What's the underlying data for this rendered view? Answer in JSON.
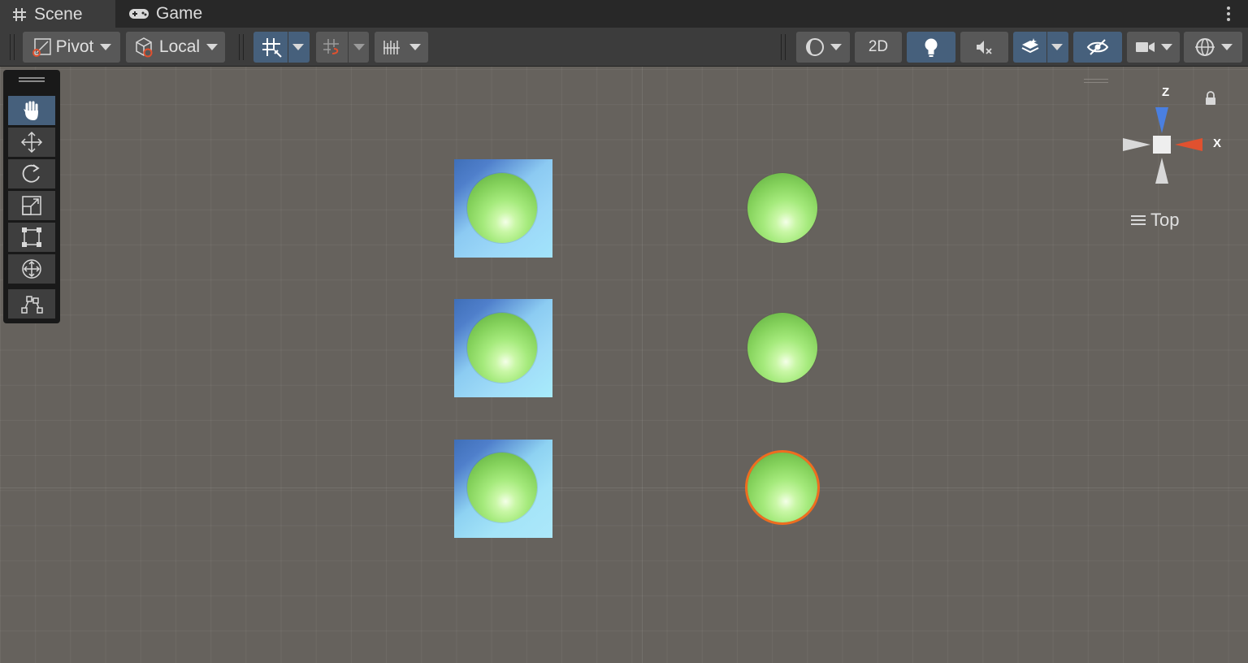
{
  "tabs": [
    {
      "label": "Scene",
      "icon": "grid-hash-icon",
      "active": true
    },
    {
      "label": "Game",
      "icon": "gamepad-icon",
      "active": false
    }
  ],
  "toolbar": {
    "pivot_label": "Pivot",
    "space_label": "Local",
    "mode_2d_label": "2D",
    "grid_snap_active": true,
    "lighting_active": true,
    "visibility_active": true
  },
  "tools": [
    {
      "name": "hand-tool",
      "icon": "hand-icon",
      "active": true
    },
    {
      "name": "move-tool",
      "icon": "move-arrows-icon",
      "active": false
    },
    {
      "name": "rotate-tool",
      "icon": "rotate-icon",
      "active": false
    },
    {
      "name": "scale-tool",
      "icon": "scale-icon",
      "active": false
    },
    {
      "name": "rect-tool",
      "icon": "rect-transform-icon",
      "active": false
    },
    {
      "name": "transform-tool",
      "icon": "transform-icon",
      "active": false
    },
    {
      "name": "custom-tool",
      "icon": "custom-editor-tool-icon",
      "active": false
    }
  ],
  "gizmo": {
    "z_label": "Z",
    "x_label": "X",
    "view_label": "Top",
    "colors": {
      "x": "#e0512f",
      "z": "#4a7fe0",
      "neutral": "#d8d8d8"
    }
  },
  "scene": {
    "cube_color": "#9cd8f8",
    "sphere_color": "#a5ea7c",
    "selection_color": "#ef6d1f",
    "objects": [
      {
        "type": "cube-with-sphere",
        "row": 1
      },
      {
        "type": "cube-with-sphere",
        "row": 2
      },
      {
        "type": "cube-with-sphere",
        "row": 3
      },
      {
        "type": "sphere",
        "row": 1,
        "selected": false
      },
      {
        "type": "sphere",
        "row": 2,
        "selected": false
      },
      {
        "type": "sphere",
        "row": 3,
        "selected": true
      }
    ]
  }
}
